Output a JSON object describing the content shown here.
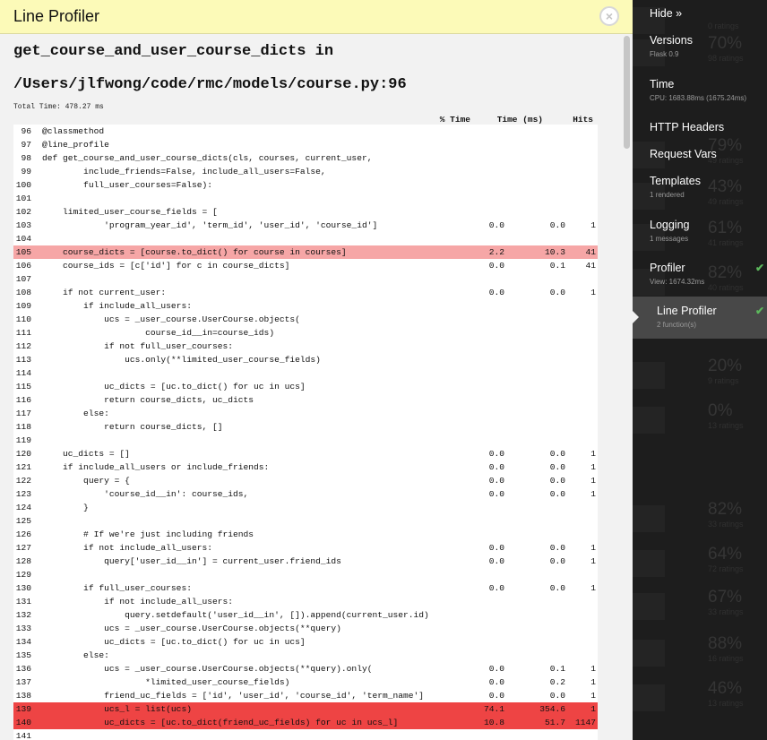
{
  "panel": {
    "title": "Line Profiler",
    "close_icon": "×",
    "func_line1": "get_course_and_user_course_dicts in",
    "func_line2": "/Users/jlfwong/code/rmc/models/course.py:96",
    "total_time": "Total Time: 478.27 ms",
    "headers": {
      "pct": "% Time",
      "time_ms": "Time (ms)",
      "hits": "Hits"
    }
  },
  "rows": [
    {
      "ln": "96",
      "code": "@classmethod",
      "pct": "",
      "ms": "",
      "hits": "",
      "hl": ""
    },
    {
      "ln": "97",
      "code": "@line_profile",
      "pct": "",
      "ms": "",
      "hits": "",
      "hl": ""
    },
    {
      "ln": "98",
      "code": "def get_course_and_user_course_dicts(cls, courses, current_user,",
      "pct": "",
      "ms": "",
      "hits": "",
      "hl": ""
    },
    {
      "ln": "99",
      "code": "        include_friends=False, include_all_users=False,",
      "pct": "",
      "ms": "",
      "hits": "",
      "hl": ""
    },
    {
      "ln": "100",
      "code": "        full_user_courses=False):",
      "pct": "",
      "ms": "",
      "hits": "",
      "hl": ""
    },
    {
      "ln": "101",
      "code": "",
      "pct": "",
      "ms": "",
      "hits": "",
      "hl": ""
    },
    {
      "ln": "102",
      "code": "    limited_user_course_fields = [",
      "pct": "",
      "ms": "",
      "hits": "",
      "hl": ""
    },
    {
      "ln": "103",
      "code": "            'program_year_id', 'term_id', 'user_id', 'course_id']",
      "pct": "0.0",
      "ms": "0.0",
      "hits": "1",
      "hl": ""
    },
    {
      "ln": "104",
      "code": "",
      "pct": "",
      "ms": "",
      "hits": "",
      "hl": ""
    },
    {
      "ln": "105",
      "code": "    course_dicts = [course.to_dict() for course in courses]",
      "pct": "2.2",
      "ms": "10.3",
      "hits": "41",
      "hl": "light"
    },
    {
      "ln": "106",
      "code": "    course_ids = [c['id'] for c in course_dicts]",
      "pct": "0.0",
      "ms": "0.1",
      "hits": "41",
      "hl": ""
    },
    {
      "ln": "107",
      "code": "",
      "pct": "",
      "ms": "",
      "hits": "",
      "hl": ""
    },
    {
      "ln": "108",
      "code": "    if not current_user:",
      "pct": "0.0",
      "ms": "0.0",
      "hits": "1",
      "hl": ""
    },
    {
      "ln": "109",
      "code": "        if include_all_users:",
      "pct": "",
      "ms": "",
      "hits": "",
      "hl": ""
    },
    {
      "ln": "110",
      "code": "            ucs = _user_course.UserCourse.objects(",
      "pct": "",
      "ms": "",
      "hits": "",
      "hl": ""
    },
    {
      "ln": "111",
      "code": "                    course_id__in=course_ids)",
      "pct": "",
      "ms": "",
      "hits": "",
      "hl": ""
    },
    {
      "ln": "112",
      "code": "            if not full_user_courses:",
      "pct": "",
      "ms": "",
      "hits": "",
      "hl": ""
    },
    {
      "ln": "113",
      "code": "                ucs.only(**limited_user_course_fields)",
      "pct": "",
      "ms": "",
      "hits": "",
      "hl": ""
    },
    {
      "ln": "114",
      "code": "",
      "pct": "",
      "ms": "",
      "hits": "",
      "hl": ""
    },
    {
      "ln": "115",
      "code": "            uc_dicts = [uc.to_dict() for uc in ucs]",
      "pct": "",
      "ms": "",
      "hits": "",
      "hl": ""
    },
    {
      "ln": "116",
      "code": "            return course_dicts, uc_dicts",
      "pct": "",
      "ms": "",
      "hits": "",
      "hl": ""
    },
    {
      "ln": "117",
      "code": "        else:",
      "pct": "",
      "ms": "",
      "hits": "",
      "hl": ""
    },
    {
      "ln": "118",
      "code": "            return course_dicts, []",
      "pct": "",
      "ms": "",
      "hits": "",
      "hl": ""
    },
    {
      "ln": "119",
      "code": "",
      "pct": "",
      "ms": "",
      "hits": "",
      "hl": ""
    },
    {
      "ln": "120",
      "code": "    uc_dicts = []",
      "pct": "0.0",
      "ms": "0.0",
      "hits": "1",
      "hl": ""
    },
    {
      "ln": "121",
      "code": "    if include_all_users or include_friends:",
      "pct": "0.0",
      "ms": "0.0",
      "hits": "1",
      "hl": ""
    },
    {
      "ln": "122",
      "code": "        query = {",
      "pct": "0.0",
      "ms": "0.0",
      "hits": "1",
      "hl": ""
    },
    {
      "ln": "123",
      "code": "            'course_id__in': course_ids,",
      "pct": "0.0",
      "ms": "0.0",
      "hits": "1",
      "hl": ""
    },
    {
      "ln": "124",
      "code": "        }",
      "pct": "",
      "ms": "",
      "hits": "",
      "hl": ""
    },
    {
      "ln": "125",
      "code": "",
      "pct": "",
      "ms": "",
      "hits": "",
      "hl": ""
    },
    {
      "ln": "126",
      "code": "        # If we're just including friends",
      "pct": "",
      "ms": "",
      "hits": "",
      "hl": ""
    },
    {
      "ln": "127",
      "code": "        if not include_all_users:",
      "pct": "0.0",
      "ms": "0.0",
      "hits": "1",
      "hl": ""
    },
    {
      "ln": "128",
      "code": "            query['user_id__in'] = current_user.friend_ids",
      "pct": "0.0",
      "ms": "0.0",
      "hits": "1",
      "hl": ""
    },
    {
      "ln": "129",
      "code": "",
      "pct": "",
      "ms": "",
      "hits": "",
      "hl": ""
    },
    {
      "ln": "130",
      "code": "        if full_user_courses:",
      "pct": "0.0",
      "ms": "0.0",
      "hits": "1",
      "hl": ""
    },
    {
      "ln": "131",
      "code": "            if not include_all_users:",
      "pct": "",
      "ms": "",
      "hits": "",
      "hl": ""
    },
    {
      "ln": "132",
      "code": "                query.setdefault('user_id__in', []).append(current_user.id)",
      "pct": "",
      "ms": "",
      "hits": "",
      "hl": ""
    },
    {
      "ln": "133",
      "code": "            ucs = _user_course.UserCourse.objects(**query)",
      "pct": "",
      "ms": "",
      "hits": "",
      "hl": ""
    },
    {
      "ln": "134",
      "code": "            uc_dicts = [uc.to_dict() for uc in ucs]",
      "pct": "",
      "ms": "",
      "hits": "",
      "hl": ""
    },
    {
      "ln": "135",
      "code": "        else:",
      "pct": "",
      "ms": "",
      "hits": "",
      "hl": ""
    },
    {
      "ln": "136",
      "code": "            ucs = _user_course.UserCourse.objects(**query).only(",
      "pct": "0.0",
      "ms": "0.1",
      "hits": "1",
      "hl": ""
    },
    {
      "ln": "137",
      "code": "                    *limited_user_course_fields)",
      "pct": "0.0",
      "ms": "0.2",
      "hits": "1",
      "hl": ""
    },
    {
      "ln": "138",
      "code": "            friend_uc_fields = ['id', 'user_id', 'course_id', 'term_name']",
      "pct": "0.0",
      "ms": "0.0",
      "hits": "1",
      "hl": ""
    },
    {
      "ln": "139",
      "code": "            ucs_l = list(ucs)",
      "pct": "74.1",
      "ms": "354.6",
      "hits": "1",
      "hl": "dark"
    },
    {
      "ln": "140",
      "code": "            uc_dicts = [uc.to_dict(friend_uc_fields) for uc in ucs_l]",
      "pct": "10.8",
      "ms": "51.7",
      "hits": "1147",
      "hl": "dark"
    },
    {
      "ln": "141",
      "code": "",
      "pct": "",
      "ms": "",
      "hits": "",
      "hl": ""
    }
  ],
  "sidebar": {
    "hide": "Hide »",
    "items": [
      {
        "label": "Versions",
        "sub": "Flask 0.9",
        "check": ""
      },
      {
        "label": "Time",
        "sub": "CPU: 1683.88ms (1675.24ms)",
        "check": ""
      },
      {
        "label": "HTTP Headers",
        "sub": "",
        "check": ""
      },
      {
        "label": "Request Vars",
        "sub": "",
        "check": ""
      },
      {
        "label": "Templates",
        "sub": "1 rendered",
        "check": ""
      },
      {
        "label": "Logging",
        "sub": "1 messages",
        "check": ""
      },
      {
        "label": "Profiler",
        "sub": "View: 1674.32ms",
        "check": "✔"
      },
      {
        "label": "Line Profiler",
        "sub": "2 function(s)",
        "check": "✔"
      }
    ],
    "ghost": [
      {
        "pct": "",
        "sub": "0 ratings"
      },
      {
        "pct": "70%",
        "sub": "98 ratings"
      },
      {
        "pct": "79%",
        "sub": "49 ratings"
      },
      {
        "pct": "43%",
        "sub": "49 ratings"
      },
      {
        "pct": "61%",
        "sub": "41 ratings"
      },
      {
        "pct": "82%",
        "sub": "40 ratings"
      },
      {
        "pct": "20%",
        "sub": "9 ratings"
      },
      {
        "pct": "0%",
        "sub": "13 ratings"
      },
      {
        "pct": "82%",
        "sub": "33 ratings"
      },
      {
        "pct": "64%",
        "sub": "72 ratings"
      },
      {
        "pct": "67%",
        "sub": "33 ratings"
      },
      {
        "pct": "88%",
        "sub": "16 ratings"
      },
      {
        "pct": "46%",
        "sub": "13 ratings"
      }
    ]
  }
}
